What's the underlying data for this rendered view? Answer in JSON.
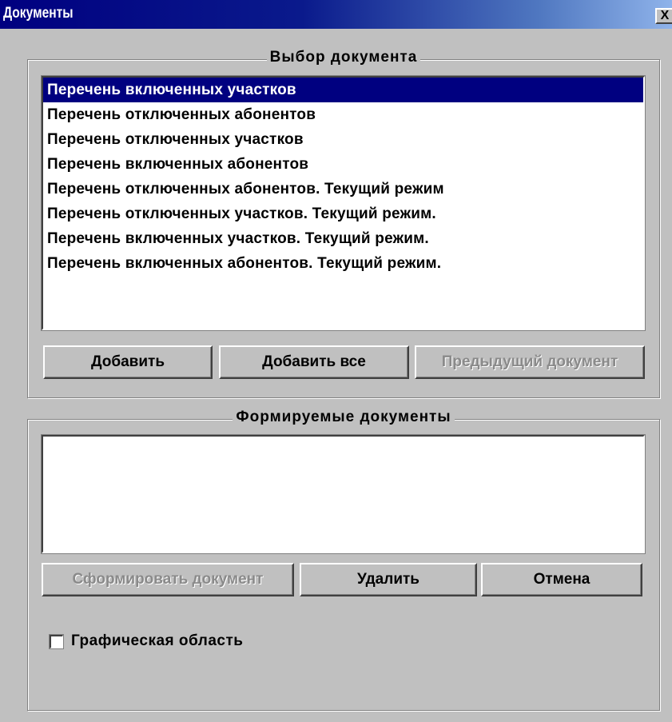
{
  "window": {
    "title": "Документы",
    "close_label": "X"
  },
  "select_group": {
    "legend": "Выбор документа",
    "items": [
      {
        "label": "Перечень включенных участков",
        "selected": true
      },
      {
        "label": "Перечень отключенных абонентов",
        "selected": false
      },
      {
        "label": "Перечень отключенных участков",
        "selected": false
      },
      {
        "label": "Перечень включенных абонентов",
        "selected": false
      },
      {
        "label": "Перечень отключенных абонентов. Текущий режим",
        "selected": false
      },
      {
        "label": "Перечень отключенных участков. Текущий режим.",
        "selected": false
      },
      {
        "label": "Перечень включенных участков. Текущий режим.",
        "selected": false
      },
      {
        "label": "Перечень включенных абонентов. Текущий режим.",
        "selected": false
      }
    ],
    "buttons": {
      "add": "Добавить",
      "add_all": "Добавить все",
      "previous": "Предыдущий документ"
    }
  },
  "output_group": {
    "legend": "Формируемые документы",
    "items": [],
    "buttons": {
      "generate": "Сформировать документ",
      "delete": "Удалить",
      "cancel": "Отмена"
    }
  },
  "options": {
    "graphic_area_label": "Графическая область",
    "graphic_area_checked": false
  },
  "colors": {
    "face": "#c0c0c0",
    "selection": "#000080",
    "disabled_text": "#8a8a8a"
  }
}
